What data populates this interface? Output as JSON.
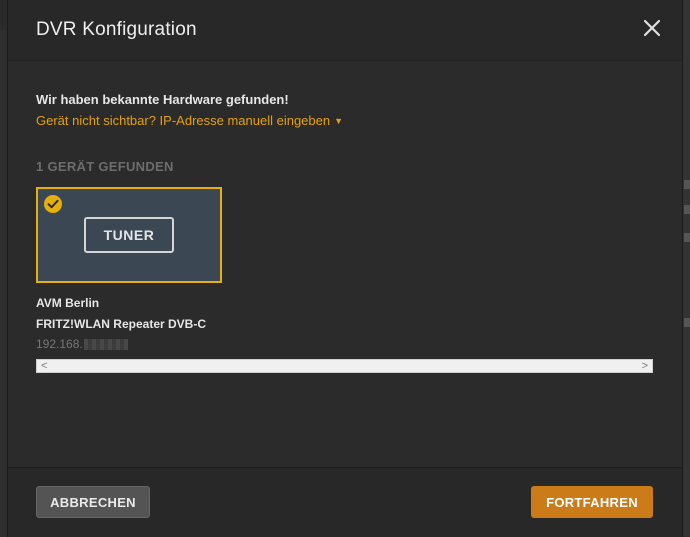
{
  "dialog": {
    "title": "DVR Konfiguration",
    "close_icon": "close-icon"
  },
  "body": {
    "found_text": "Wir haben bekannte Hardware gefunden!",
    "manual_link": "Gerät nicht sichtbar? IP-Adresse manuell eingeben",
    "manual_link_caret": "▼",
    "section_title": "1 GERÄT GEFUNDEN",
    "device": {
      "label": "TUNER",
      "selected": true,
      "brand": "AVM Berlin",
      "model": "FRITZ!WLAN Repeater DVB-C",
      "ip_visible": "192.168."
    },
    "scroll_left": "<",
    "scroll_right": ">"
  },
  "footer": {
    "cancel_label": "ABBRECHEN",
    "continue_label": "FORTFAHREN"
  },
  "colors": {
    "accent": "#e5a00d",
    "selection_border": "#e5b00d",
    "primary_button": "#cc7b19",
    "card_background": "#3b4753"
  }
}
